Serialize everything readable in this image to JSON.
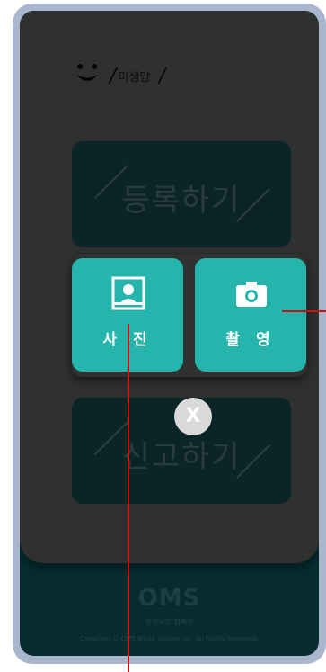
{
  "header": {
    "app_name": "미생맘"
  },
  "panels": {
    "register_label": "등록하기",
    "report_label": "신고하기"
  },
  "choices": {
    "photo_label": "사 진",
    "shoot_label": "촬 영",
    "close_label": "X"
  },
  "footer": {
    "logo": "OMS",
    "tagline": "환경보호 캠페인",
    "copyright": "Copyright © OMS World Society Inc. All Rights Reserved."
  },
  "colors": {
    "accent": "#25b5ad",
    "card": "#2f3030",
    "screen": "#062c2f",
    "device_frame": "#a9b6cd",
    "annotation": "#cc1111"
  },
  "icons": {
    "logo": "smiley-icon",
    "photo": "portrait-icon",
    "shoot": "camera-icon",
    "close": "close-icon"
  }
}
